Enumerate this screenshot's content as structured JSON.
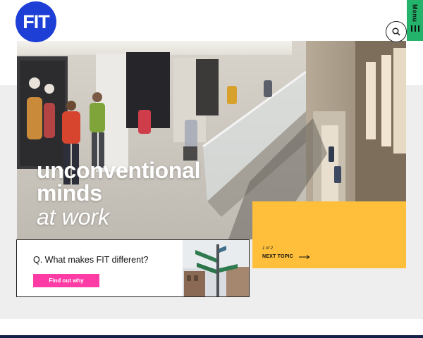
{
  "header": {
    "logo_text": "FIT",
    "menu_label": "Menu",
    "search_icon": "search-icon"
  },
  "hero": {
    "tagline_line1": "unconventional",
    "tagline_line2": "minds",
    "tagline_line3": "at work",
    "image": "atrium-photo"
  },
  "topic": {
    "count": "1 of 2",
    "next_label": "NEXT TOPIC"
  },
  "card": {
    "question": "Q. What makes FIT different?",
    "cta_label": "Find out why",
    "thumb": "street-sign-photo"
  },
  "colors": {
    "brand_blue": "#1d3fd6",
    "menu_green": "#23b36a",
    "topic_yellow": "#ffbf3a",
    "cta_pink": "#ff3ba5",
    "footer_navy": "#14224a"
  }
}
